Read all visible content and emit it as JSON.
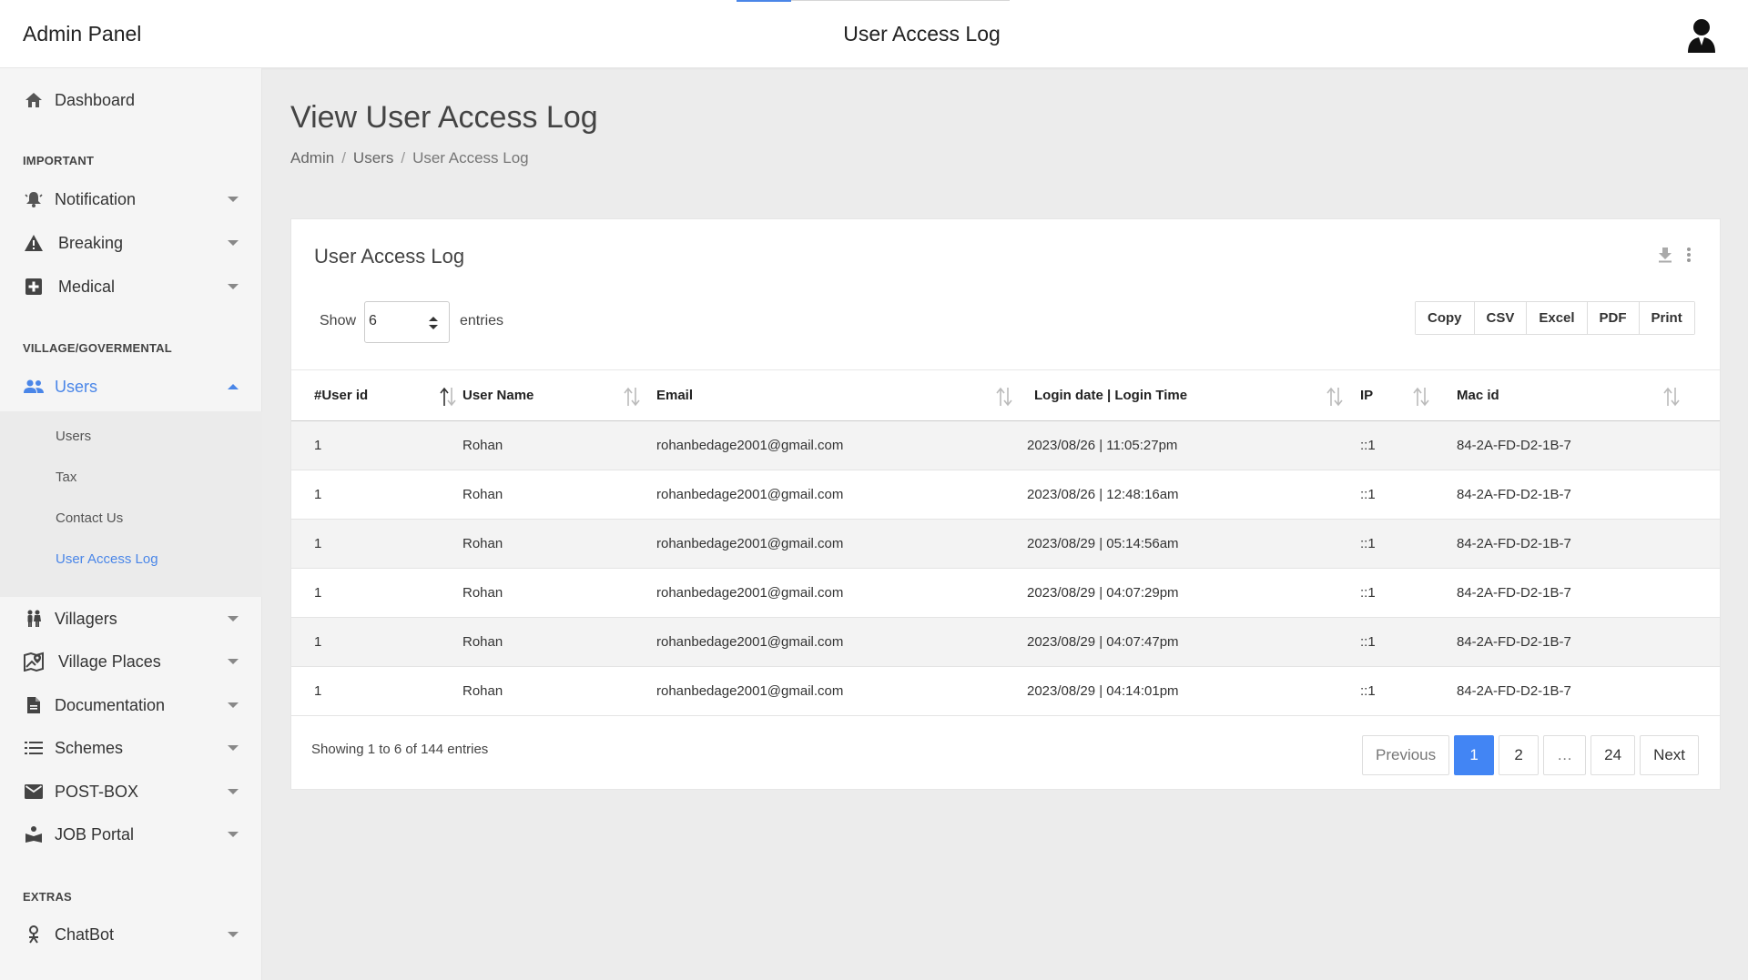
{
  "topbar": {
    "brand": "Admin Panel",
    "title": "User Access Log",
    "avatar_icon": "user-avatar-icon"
  },
  "sidebar": {
    "dashboard": "Dashboard",
    "section_important": "IMPORTANT",
    "notification": "Notification",
    "breaking": "Breaking",
    "medical": "Medical",
    "section_village": "VILLAGE/GOVERMENTAL",
    "users": "Users",
    "sub": {
      "users": "Users",
      "tax": "Tax",
      "contact": "Contact Us",
      "access_log": "User Access Log"
    },
    "villagers": "Villagers",
    "village_places": "Village Places",
    "documentation": "Documentation",
    "schemes": "Schemes",
    "postbox": "POST-BOX",
    "job_portal": "JOB Portal",
    "section_extras": "EXTRAS",
    "chatbot": "ChatBot"
  },
  "page": {
    "title": "View User Access Log",
    "breadcrumb": [
      "Admin",
      "Users",
      "User Access Log"
    ],
    "breadcrumb_sep": "/"
  },
  "card": {
    "title": "User Access Log",
    "show_label": "Show",
    "show_value": "6",
    "entries_label": "entries",
    "exports": [
      "Copy",
      "CSV",
      "Excel",
      "PDF",
      "Print"
    ],
    "columns": [
      "#User id",
      "User Name",
      "Email",
      "Login date | Login Time",
      "IP",
      "Mac id"
    ],
    "rows": [
      [
        "1",
        "Rohan",
        "rohanbedage2001@gmail.com",
        "2023/08/26 | 11:05:27pm",
        "::1",
        "84-2A-FD-D2-1B-7"
      ],
      [
        "1",
        "Rohan",
        "rohanbedage2001@gmail.com",
        "2023/08/26 | 12:48:16am",
        "::1",
        "84-2A-FD-D2-1B-7"
      ],
      [
        "1",
        "Rohan",
        "rohanbedage2001@gmail.com",
        "2023/08/29 | 05:14:56am",
        "::1",
        "84-2A-FD-D2-1B-7"
      ],
      [
        "1",
        "Rohan",
        "rohanbedage2001@gmail.com",
        "2023/08/29 | 04:07:29pm",
        "::1",
        "84-2A-FD-D2-1B-7"
      ],
      [
        "1",
        "Rohan",
        "rohanbedage2001@gmail.com",
        "2023/08/29 | 04:07:47pm",
        "::1",
        "84-2A-FD-D2-1B-7"
      ],
      [
        "1",
        "Rohan",
        "rohanbedage2001@gmail.com",
        "2023/08/29 | 04:14:01pm",
        "::1",
        "84-2A-FD-D2-1B-7"
      ]
    ],
    "info": "Showing 1 to 6 of 144 entries",
    "pager": {
      "previous": "Previous",
      "pages": [
        "1",
        "2",
        "…",
        "24"
      ],
      "next": "Next",
      "active": "1"
    }
  },
  "colors": {
    "accent": "#4285f4",
    "active_text": "#4a86e8"
  }
}
